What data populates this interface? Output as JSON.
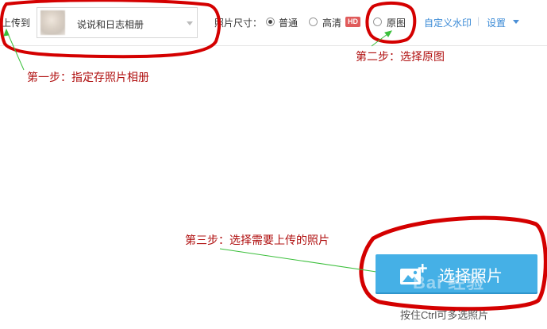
{
  "toolbar": {
    "upload_to_label": "上传到",
    "album_name": "说说和日志相册",
    "size_label": "照片尺寸：",
    "options": [
      {
        "label": "普通",
        "checked": true
      },
      {
        "label": "高清",
        "checked": false
      },
      {
        "label": "原图",
        "checked": false
      }
    ],
    "hd_badge": "HD",
    "watermark_link": "自定义水印",
    "divider": "|",
    "settings_link": "设置"
  },
  "annotations": {
    "step1": "第一步：指定存照片相册",
    "step2": "第二步：选择原图",
    "step3": "第三步：选择需要上传的照片"
  },
  "main": {
    "select_button_label": "选择照片",
    "hint": "按住Ctrl可多选照片",
    "watermark_text": "Bai 经验"
  },
  "colors": {
    "annotation_red": "#d40000",
    "button_blue": "#45b0e6",
    "link_blue": "#3a8ad6",
    "arrow_green": "#3bbf3b"
  }
}
